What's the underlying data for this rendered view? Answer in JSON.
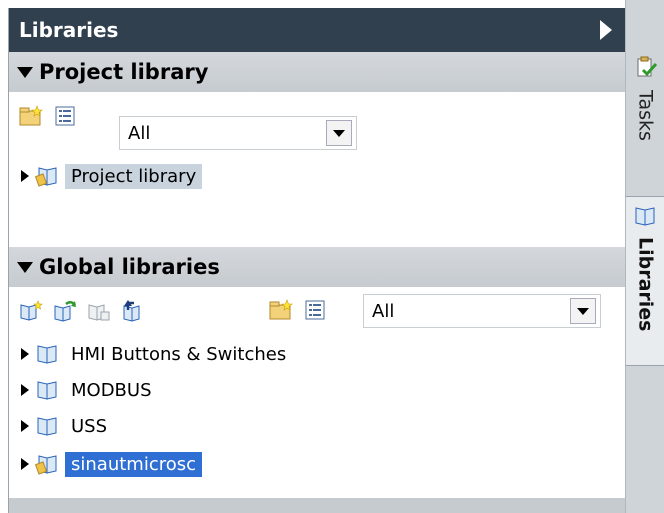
{
  "panel": {
    "title": "Libraries"
  },
  "project_library": {
    "header": "Project library",
    "filter": {
      "value": "All"
    },
    "items": [
      {
        "label": "Project library",
        "selected": "light"
      }
    ]
  },
  "global_libraries": {
    "header": "Global libraries",
    "filter": {
      "value": "All"
    },
    "items": [
      {
        "label": "HMI Buttons & Switches"
      },
      {
        "label": "MODBUS"
      },
      {
        "label": "USS"
      },
      {
        "label": "sinautmicrosc",
        "selected": "dark"
      }
    ]
  },
  "side_tabs": [
    {
      "label": "Tasks",
      "icon": "tasks-icon"
    },
    {
      "label": "Libraries",
      "icon": "library-book-icon",
      "active": true
    }
  ],
  "colors": {
    "titlebar": "#30404f",
    "section_header": "#c6cbd0",
    "selection_dark": "#2f6fd3",
    "selection_light": "#c9d3dd"
  }
}
